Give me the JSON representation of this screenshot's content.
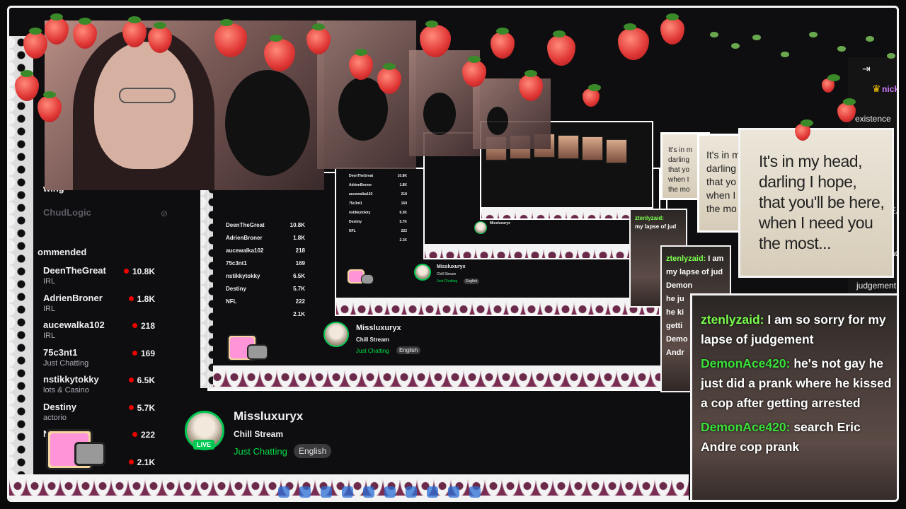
{
  "sidebar": {
    "following_label": "wing",
    "offline_channel": "ChudLogic",
    "recommended_label": "ommended",
    "channels": [
      {
        "name": "DeenTheGreat",
        "category": "IRL",
        "viewers": "10.8K",
        "live": true
      },
      {
        "name": "AdrienBroner",
        "category": "IRL",
        "viewers": "1.8K",
        "live": true
      },
      {
        "name": "aucewalka102",
        "category": "IRL",
        "viewers": "218",
        "live": true
      },
      {
        "name": "75c3nt1",
        "category": "Just Chatting",
        "viewers": "169",
        "live": true
      },
      {
        "name": "nstikkytokky",
        "category": "lots & Casino",
        "viewers": "6.5K",
        "live": true
      },
      {
        "name": "Destiny",
        "category": "actorio",
        "viewers": "5.7K",
        "live": true
      },
      {
        "name": "NFL",
        "category": "",
        "viewers": "222",
        "live": true
      },
      {
        "name": "",
        "category": "",
        "viewers": "2.1K",
        "live": true
      }
    ]
  },
  "stream_info": {
    "channel_name": "Missluxuryx",
    "title": "Chill Stream",
    "category": "Just Chatting",
    "language_tag": "English",
    "live_badge": "LIVE"
  },
  "lyric_card": {
    "lines": [
      "It's in my head,",
      "darling I hope,",
      "that you'll be here,",
      "when I need you",
      "the most..."
    ]
  },
  "lyric_card_small": {
    "lines": [
      "It's in m",
      "darling",
      "that yo",
      "when I",
      "the mo"
    ]
  },
  "chat": {
    "messages": [
      {
        "user": "ztenlyzaid:",
        "text": "I am so sorry for my lapse of judgement",
        "color": "#7bff4d"
      },
      {
        "user": "DemonAce420:",
        "text": "he's not gay he just did a prank where he kissed a cop after getting arrested",
        "color": "#3ae03a"
      },
      {
        "user": "DemonAce420:",
        "text": "search Eric Andre cop prank",
        "color": "#3ae03a"
      }
    ],
    "small_messages": [
      {
        "user": "ztenlyzaid:",
        "text": "I am"
      },
      {
        "user": "",
        "text": "my lapse of jud"
      },
      {
        "user": "Demon",
        "text": ""
      },
      {
        "user": "",
        "text": "he ju"
      },
      {
        "user": "",
        "text": "he ki"
      },
      {
        "user": "",
        "text": "getti"
      },
      {
        "user": "Demo",
        "text": ""
      },
      {
        "user": "",
        "text": "Andr"
      }
    ]
  },
  "right_strip": {
    "user": "nick_",
    "user_small": "nick",
    "word1": "existence",
    "word2": "EAR",
    "word3": "ad:",
    "word4": "judgement"
  },
  "colors": {
    "accent_live": "#00c853",
    "category_green": "#00e046",
    "live_dot": "#eb0400",
    "background": "#0e0e10"
  }
}
